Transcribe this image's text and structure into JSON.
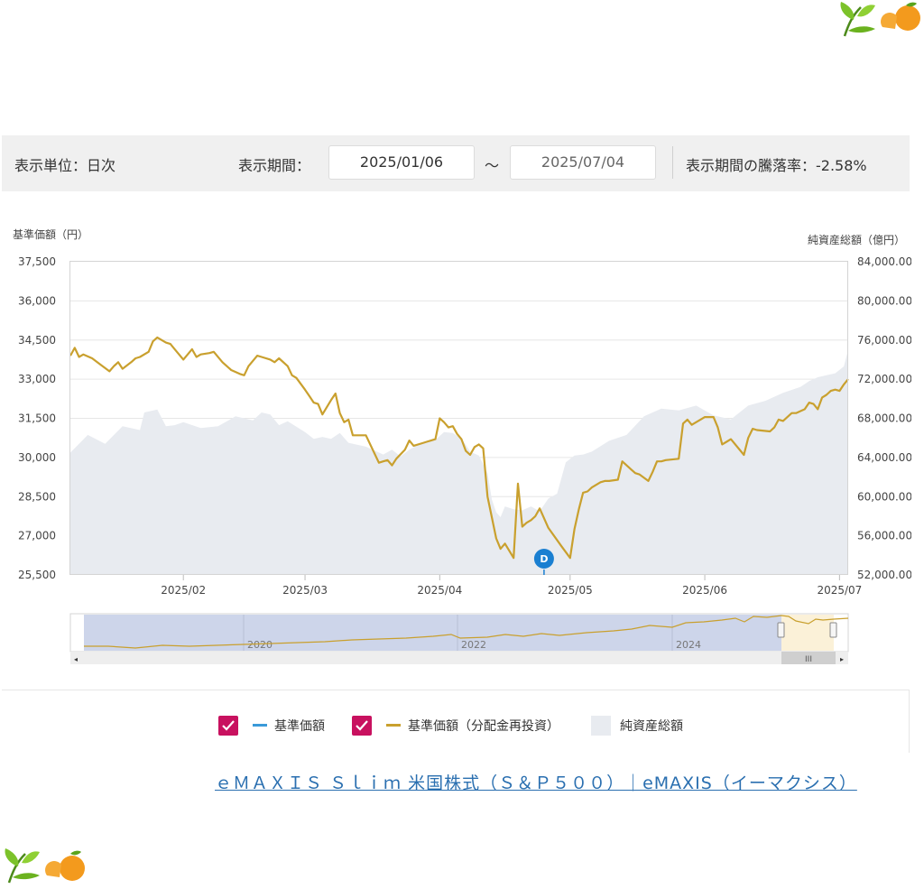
{
  "toolbar": {
    "unit_label": "表示単位：日次",
    "period_label": "表示期間：",
    "start_date": "2025/01/06",
    "tilde": "～",
    "end_date": "2025/07/04",
    "change_label": "表示期間の騰落率：-2.58%"
  },
  "chart_data": {
    "type": "line",
    "left_axis_title": "基準価額（円）",
    "right_axis_title": "純資産総額（億円）",
    "left_ticks": [
      "37,500",
      "36,000",
      "34,500",
      "33,000",
      "31,500",
      "30,000",
      "28,500",
      "27,000",
      "25,500"
    ],
    "right_ticks": [
      "84,000.00",
      "80,000.00",
      "76,000.00",
      "72,000.00",
      "68,000.00",
      "64,000.00",
      "60,000.00",
      "56,000.00",
      "52,000.00"
    ],
    "ylim_left": [
      25500,
      37500
    ],
    "ylim_right": [
      52000,
      84000
    ],
    "x_ticks": [
      "2025/02",
      "2025/03",
      "2025/04",
      "2025/05",
      "2025/06",
      "2025/07"
    ],
    "x_tick_days": [
      26,
      54,
      85,
      115,
      146,
      177
    ],
    "xlim_days": [
      0,
      179
    ],
    "marker": {
      "label": "D",
      "day": 109,
      "color": "#1a7fd1"
    },
    "series": [
      {
        "name": "基準価額（分配金再投資）",
        "color": "#c9a02e",
        "x": [
          0,
          1,
          2,
          3,
          5,
          7,
          9,
          10,
          11,
          12,
          14,
          15,
          16,
          18,
          19,
          20,
          22,
          23,
          24,
          26,
          28,
          29,
          30,
          32,
          33,
          35,
          37,
          39,
          40,
          41,
          43,
          44,
          46,
          47,
          48,
          50,
          51,
          52,
          54,
          55,
          56,
          57,
          58,
          60,
          61,
          62,
          63,
          64,
          65,
          66,
          67,
          68,
          71,
          72,
          73,
          74,
          75,
          77,
          78,
          79,
          81,
          82,
          83,
          84,
          85,
          86,
          87,
          88,
          89,
          90,
          91,
          92,
          93,
          94,
          95,
          96,
          97,
          98,
          99,
          100,
          102,
          103,
          104,
          105,
          106,
          107,
          108,
          110,
          113,
          115,
          116,
          117,
          118,
          119,
          120,
          121,
          122,
          123,
          124,
          126,
          127,
          128,
          129,
          130,
          131,
          133,
          134,
          135,
          136,
          137,
          140,
          141,
          142,
          143,
          145,
          146,
          147,
          148,
          149,
          150,
          151,
          152,
          155,
          156,
          157,
          158,
          161,
          162,
          163,
          164,
          165,
          166,
          167,
          169,
          170,
          171,
          172,
          173,
          174,
          175,
          176,
          177,
          178,
          179
        ],
        "values": [
          33900,
          34200,
          33850,
          33950,
          33800,
          33550,
          33300,
          33500,
          33650,
          33400,
          33650,
          33800,
          33850,
          34050,
          34450,
          34600,
          34400,
          34350,
          34150,
          33750,
          34150,
          33850,
          33950,
          34000,
          34050,
          33650,
          33350,
          33200,
          33150,
          33500,
          33900,
          33850,
          33750,
          33650,
          33800,
          33500,
          33150,
          33050,
          32600,
          32350,
          32100,
          32050,
          31650,
          32200,
          32450,
          31700,
          31350,
          31450,
          30850,
          30850,
          30850,
          30850,
          29800,
          29850,
          29900,
          29700,
          29950,
          30300,
          30650,
          30450,
          30550,
          30600,
          30650,
          30700,
          31500,
          31350,
          31150,
          31200,
          30900,
          30700,
          30250,
          30100,
          30400,
          30500,
          30350,
          28500,
          27700,
          26900,
          26500,
          26700,
          26150,
          29000,
          27350,
          27500,
          27600,
          27750,
          28050,
          27300,
          26600,
          26150,
          27250,
          28000,
          28650,
          28700,
          28850,
          28950,
          29050,
          29100,
          29100,
          29150,
          29850,
          29700,
          29550,
          29400,
          29350,
          29100,
          29450,
          29850,
          29850,
          29900,
          29950,
          31300,
          31450,
          31250,
          31450,
          31550,
          31550,
          31550,
          31150,
          30500,
          30600,
          30700,
          30100,
          30750,
          31100,
          31050,
          31000,
          31150,
          31450,
          31400,
          31550,
          31700,
          31700,
          31850,
          32100,
          32050,
          31850,
          32300,
          32400,
          32550,
          32600,
          32550,
          32800,
          33000
        ]
      },
      {
        "name": "純資産総額",
        "color": "#e8ebf0",
        "x": [
          0,
          4,
          8,
          12,
          16,
          17,
          20,
          22,
          24,
          26,
          30,
          34,
          38,
          39,
          42,
          44,
          46,
          48,
          50,
          54,
          56,
          58,
          60,
          62,
          64,
          66,
          68,
          70,
          72,
          74,
          76,
          78,
          80,
          82,
          84,
          86,
          88,
          90,
          91,
          92,
          94,
          96,
          97,
          98,
          99,
          100,
          102,
          104,
          106,
          108,
          110,
          112,
          114,
          116,
          118,
          120,
          124,
          128,
          132,
          136,
          140,
          144,
          148,
          152,
          156,
          160,
          164,
          168,
          170,
          172,
          174,
          176,
          178,
          179
        ],
        "values": [
          64500,
          66300,
          65400,
          67200,
          66800,
          68600,
          68900,
          67200,
          67300,
          67600,
          67000,
          67200,
          68200,
          68100,
          67800,
          68600,
          68400,
          67300,
          67700,
          66600,
          65900,
          66100,
          65900,
          66500,
          65500,
          65300,
          65100,
          64700,
          64300,
          64800,
          64100,
          64800,
          65300,
          65600,
          65800,
          66600,
          66500,
          65900,
          65300,
          64600,
          64200,
          62400,
          59700,
          58400,
          57900,
          59000,
          58700,
          58600,
          59000,
          58500,
          59800,
          60300,
          63500,
          64200,
          64300,
          64600,
          65700,
          66300,
          68200,
          69000,
          68800,
          69300,
          68300,
          67900,
          69300,
          69800,
          70600,
          71200,
          71800,
          72200,
          72400,
          72600,
          73300,
          75000
        ]
      }
    ]
  },
  "navigator": {
    "year_labels": [
      "2020",
      "2022",
      "2024"
    ]
  },
  "legend": {
    "items": [
      {
        "label": "基準価額",
        "color": "#3a9ad9"
      },
      {
        "label": "基準価額（分配金再投資）",
        "color": "#c9a02e"
      },
      {
        "label": "純資産総額",
        "color": "#e8ebf0"
      }
    ]
  },
  "link_text": "ｅＭＡＸＩＳ Ｓｌｉｍ 米国株式（Ｓ＆Ｐ５００）｜eMAXIS（イーマクシス）",
  "accent_color": "#c8115f"
}
